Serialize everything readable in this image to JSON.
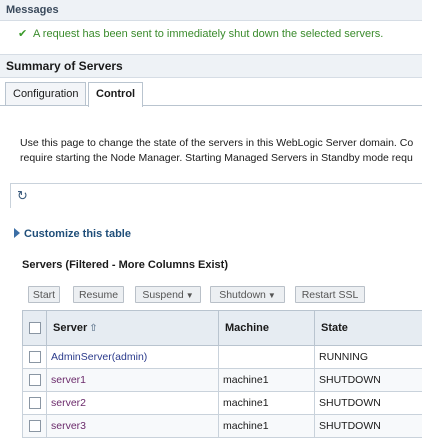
{
  "messages": {
    "title": "Messages",
    "text": "A request has been sent to immediately shut down the selected servers."
  },
  "summary": {
    "title": "Summary of Servers",
    "tabs": [
      "Configuration",
      "Control"
    ],
    "description_line1": "Use this page to change the state of the servers in this WebLogic Server domain. Co",
    "description_line2": "require starting the Node Manager. Starting Managed Servers in Standby mode requ"
  },
  "customize": "Customize this table",
  "table": {
    "caption": "Servers (Filtered - More Columns Exist)",
    "buttons": {
      "start": "Start",
      "resume": "Resume",
      "suspend": "Suspend",
      "shutdown": "Shutdown",
      "restart_ssl": "Restart SSL"
    },
    "headers": [
      "Server",
      "Machine",
      "State"
    ],
    "rows": [
      {
        "server": "AdminServer(admin)",
        "machine": "",
        "state": "RUNNING"
      },
      {
        "server": "server1",
        "machine": "machine1",
        "state": "SHUTDOWN"
      },
      {
        "server": "server2",
        "machine": "machine1",
        "state": "SHUTDOWN"
      },
      {
        "server": "server3",
        "machine": "machine1",
        "state": "SHUTDOWN"
      }
    ]
  },
  "colors": {
    "success": "#3a8b2c",
    "link": "#6b2a6b",
    "header_bg": "#e6ecf2"
  }
}
